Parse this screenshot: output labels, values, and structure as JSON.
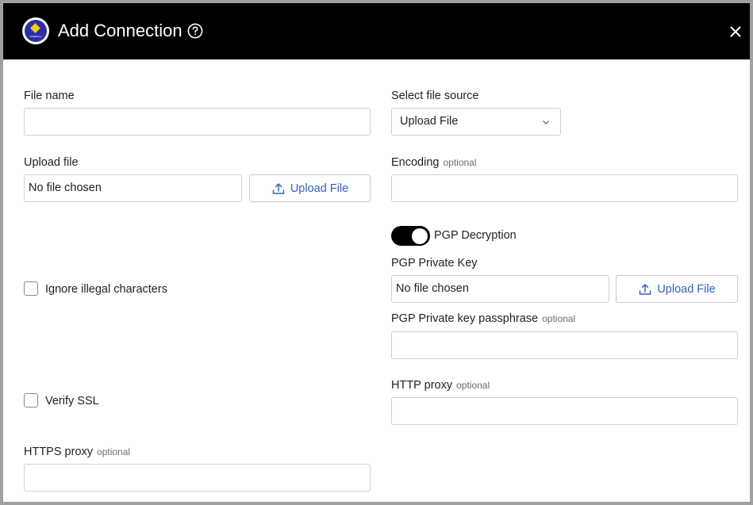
{
  "dialog": {
    "title": "Add Connection",
    "logo_text": "FORMULA"
  },
  "form": {
    "file_name": {
      "label": "File name",
      "value": ""
    },
    "file_source": {
      "label": "Select file source",
      "selected": "Upload File"
    },
    "upload_file": {
      "label": "Upload file",
      "status": "No file chosen",
      "button_label": "Upload File"
    },
    "encoding": {
      "label": "Encoding",
      "optional": "optional",
      "value": ""
    },
    "pgp_decryption": {
      "label": "PGP Decryption",
      "enabled": true
    },
    "pgp_private_key": {
      "label": "PGP Private Key",
      "status": "No file chosen",
      "button_label": "Upload File"
    },
    "ignore_illegal": {
      "label": "Ignore illegal characters",
      "checked": false
    },
    "pgp_passphrase": {
      "label": "PGP Private key passphrase",
      "optional": "optional",
      "value": ""
    },
    "verify_ssl": {
      "label": "Verify SSL",
      "checked": false
    },
    "http_proxy": {
      "label": "HTTP proxy",
      "optional": "optional",
      "value": ""
    },
    "https_proxy": {
      "label": "HTTPS proxy",
      "optional": "optional",
      "value": ""
    }
  },
  "colors": {
    "header_bg": "#000000",
    "link_blue": "#2f62c6",
    "toggle_on": "#000000"
  },
  "icons": {
    "help": "help-circle-icon",
    "close": "close-icon",
    "upload": "upload-icon",
    "chevron": "chevron-down-icon"
  }
}
